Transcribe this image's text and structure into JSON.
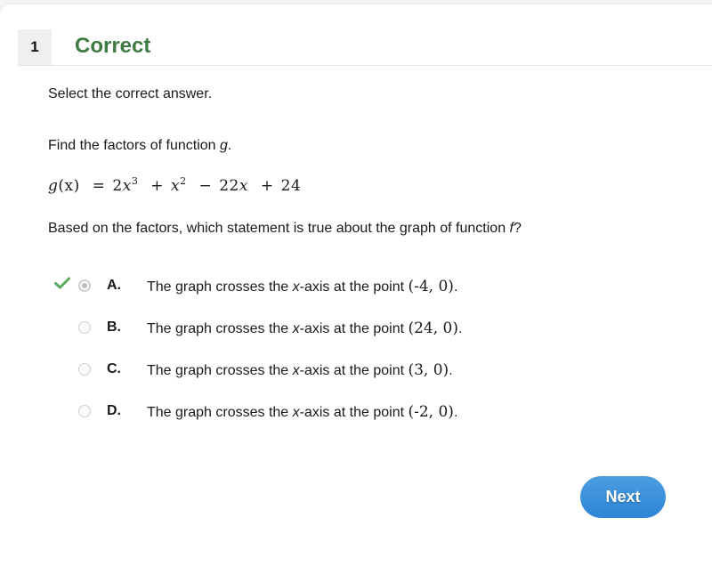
{
  "header": {
    "question_number": "1",
    "status": "Correct",
    "status_color": "#3e7b43"
  },
  "instruction": "Select the correct answer.",
  "prompt": {
    "text": "Find the factors of function ",
    "var": "g",
    "end": "."
  },
  "equation": {
    "lhs_fn": "g",
    "lhs_arg": "(x)",
    "eq": "=",
    "term1_coef": "2",
    "term1_var": "x",
    "term1_exp": "3",
    "op1": "+",
    "term2_var": "x",
    "term2_exp": "2",
    "op2": "−",
    "term3_coef": "22",
    "term3_var": "x",
    "op3": "+",
    "term4": "24"
  },
  "question": {
    "text": "Based on the factors, which statement is true about the graph of function ",
    "var": "f",
    "end": "?"
  },
  "options": [
    {
      "letter": "A.",
      "pre": "The graph crosses the ",
      "var": "x",
      "post": "-axis at the point ",
      "point": "(-4, 0)",
      "end": ".",
      "selected": true,
      "correct": true
    },
    {
      "letter": "B.",
      "pre": "The graph crosses the ",
      "var": "x",
      "post": "-axis at the point ",
      "point": "(24, 0)",
      "end": ".",
      "selected": false,
      "correct": false
    },
    {
      "letter": "C.",
      "pre": "The graph crosses the ",
      "var": "x",
      "post": "-axis at the point ",
      "point": "(3, 0)",
      "end": ".",
      "selected": false,
      "correct": false
    },
    {
      "letter": "D.",
      "pre": "The graph crosses the ",
      "var": "x",
      "post": "-axis at the point ",
      "point": "(-2, 0)",
      "end": ".",
      "selected": false,
      "correct": false
    }
  ],
  "icons": {
    "correct_marker": "checkmark-icon",
    "check_color": "#5aab5e"
  },
  "next_button": {
    "label": "Next",
    "color": "#3a92dc"
  }
}
